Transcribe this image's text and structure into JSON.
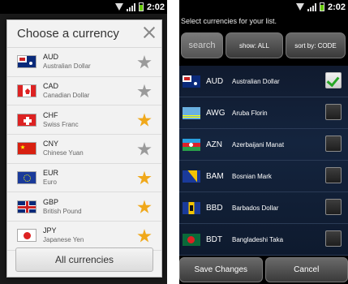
{
  "left": {
    "status_time": "2:02",
    "dialog_title": "Choose a currency",
    "currencies": [
      {
        "code": "AUD",
        "name": "Australian Dollar",
        "favorite": false
      },
      {
        "code": "CAD",
        "name": "Canadian Dollar",
        "favorite": false
      },
      {
        "code": "CHF",
        "name": "Swiss Franc",
        "favorite": true
      },
      {
        "code": "CNY",
        "name": "Chinese Yuan",
        "favorite": false
      },
      {
        "code": "EUR",
        "name": "Euro",
        "favorite": true
      },
      {
        "code": "GBP",
        "name": "British Pound",
        "favorite": true
      },
      {
        "code": "JPY",
        "name": "Japanese Yen",
        "favorite": true
      }
    ],
    "all_button": "All currencies"
  },
  "right": {
    "status_time": "2:02",
    "header": "Select currencies for your list.",
    "search_label": "search",
    "show_label": "show: ALL",
    "sort_label": "sort by: CODE",
    "currencies": [
      {
        "code": "AUD",
        "name": "Australian Dollar",
        "checked": true
      },
      {
        "code": "AWG",
        "name": "Aruba Florin",
        "checked": false
      },
      {
        "code": "AZN",
        "name": "Azerbaijani Manat",
        "checked": false
      },
      {
        "code": "BAM",
        "name": "Bosnian Mark",
        "checked": false
      },
      {
        "code": "BBD",
        "name": "Barbados Dollar",
        "checked": false
      },
      {
        "code": "BDT",
        "name": "Bangladeshi Taka",
        "checked": false
      }
    ],
    "save_button": "Save Changes",
    "cancel_button": "Cancel"
  },
  "colors": {
    "star_favorite": "#f0a81a",
    "star_default": "#9a9a9a",
    "check_green": "#25a625"
  }
}
